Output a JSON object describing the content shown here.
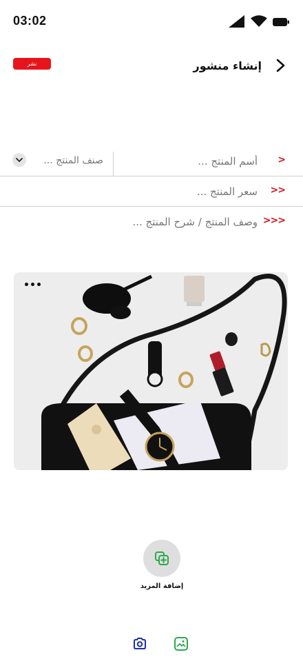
{
  "status_bar": {
    "time": "03:02",
    "icons": [
      "signal-icon",
      "wifi-icon",
      "battery-icon"
    ]
  },
  "header": {
    "title": "إنشاء منشور",
    "publish_label": "نشر",
    "back_icon": "chevron-left-icon"
  },
  "form": {
    "name_marker": ">",
    "name_placeholder": "أسم المنتج ...",
    "category_label": "صنف المنتج ...",
    "price_marker": ">>",
    "price_placeholder": "سعر المنتج ...",
    "description_marker": ">>>",
    "description_placeholder": "وصف المنتج / شرح المنتج ..."
  },
  "media": {
    "more_icon": "more-dots-icon"
  },
  "add_more": {
    "label": "إضافة المزيد",
    "icon": "add-copy-icon"
  },
  "bottom": {
    "camera_icon": "camera-icon",
    "gallery_icon": "image-gallery-icon"
  },
  "colors": {
    "accent": "#e8141b",
    "marker": "#d0141b",
    "camera": "#1a2fb0",
    "gallery": "#2aa84a"
  }
}
